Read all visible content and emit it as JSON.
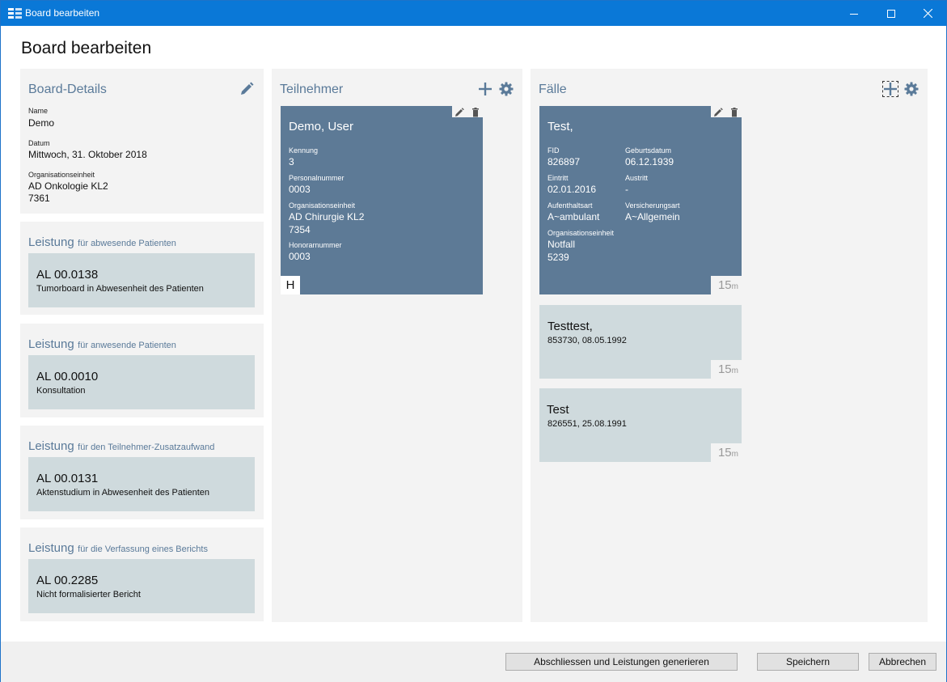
{
  "window": {
    "title": "Board bearbeiten"
  },
  "page": {
    "title": "Board bearbeiten"
  },
  "details": {
    "title": "Board-Details",
    "name_label": "Name",
    "name_value": "Demo",
    "date_label": "Datum",
    "date_value": "Mittwoch, 31. Oktober 2018",
    "org_label": "Organisationseinheit",
    "org_value1": "AD Onkologie KL2",
    "org_value2": "7361"
  },
  "leistungen": [
    {
      "head_big": "Leistung",
      "head_small": "für abwesende Patienten",
      "code": "AL 00.0138",
      "desc": "Tumorboard in Abwesenheit des Patienten"
    },
    {
      "head_big": "Leistung",
      "head_small": "für anwesende Patienten",
      "code": "AL 00.0010",
      "desc": "Konsultation"
    },
    {
      "head_big": "Leistung",
      "head_small": "für den Teilnehmer-Zusatzaufwand",
      "code": "AL 00.0131",
      "desc": "Aktenstudium in Abwesenheit des Patienten"
    },
    {
      "head_big": "Leistung",
      "head_small": "für die Verfassung eines Berichts",
      "code": "AL 00.2285",
      "desc": "Nicht formalisierter Bericht"
    }
  ],
  "participants": {
    "title": "Teilnehmer",
    "card": {
      "name": "Demo, User",
      "kennung_label": "Kennung",
      "kennung_value": "3",
      "personal_label": "Personalnummer",
      "personal_value": "0003",
      "org_label": "Organisationseinheit",
      "org_value1": "AD Chirurgie KL2",
      "org_value2": "7354",
      "honorar_label": "Honorarnummer",
      "honorar_value": "0003",
      "badge": "H"
    }
  },
  "cases": {
    "title": "Fälle",
    "main_card": {
      "name": "Test,",
      "fid_label": "FID",
      "fid_value": "826897",
      "birth_label": "Geburtsdatum",
      "birth_value": "06.12.1939",
      "entry_label": "Eintritt",
      "entry_value": "02.01.2016",
      "exit_label": "Austritt",
      "exit_value": "-",
      "stay_label": "Aufenthaltsart",
      "stay_value": "A~ambulant",
      "insurance_label": "Versicherungsart",
      "insurance_value": "A~Allgemein",
      "org_label": "Organisationseinheit",
      "org_value1": "Notfall",
      "org_value2": "5239",
      "duration_num": "15",
      "duration_unit": "m"
    },
    "other": [
      {
        "name": "Testtest,",
        "sub": "853730, 08.05.1992",
        "duration_num": "15",
        "duration_unit": "m"
      },
      {
        "name": "Test",
        "sub": "826551, 25.08.1991",
        "duration_num": "15",
        "duration_unit": "m"
      }
    ]
  },
  "footer": {
    "finish_label": "Abschliessen und Leistungen generieren",
    "save_label": "Speichern",
    "cancel_label": "Abbrechen"
  },
  "colors": {
    "titlebar": "#0a78d7",
    "accent_text": "#5a7a99",
    "card_dark": "#5d7a96",
    "card_light": "#cfdadd",
    "panel": "#f3f3f3"
  }
}
